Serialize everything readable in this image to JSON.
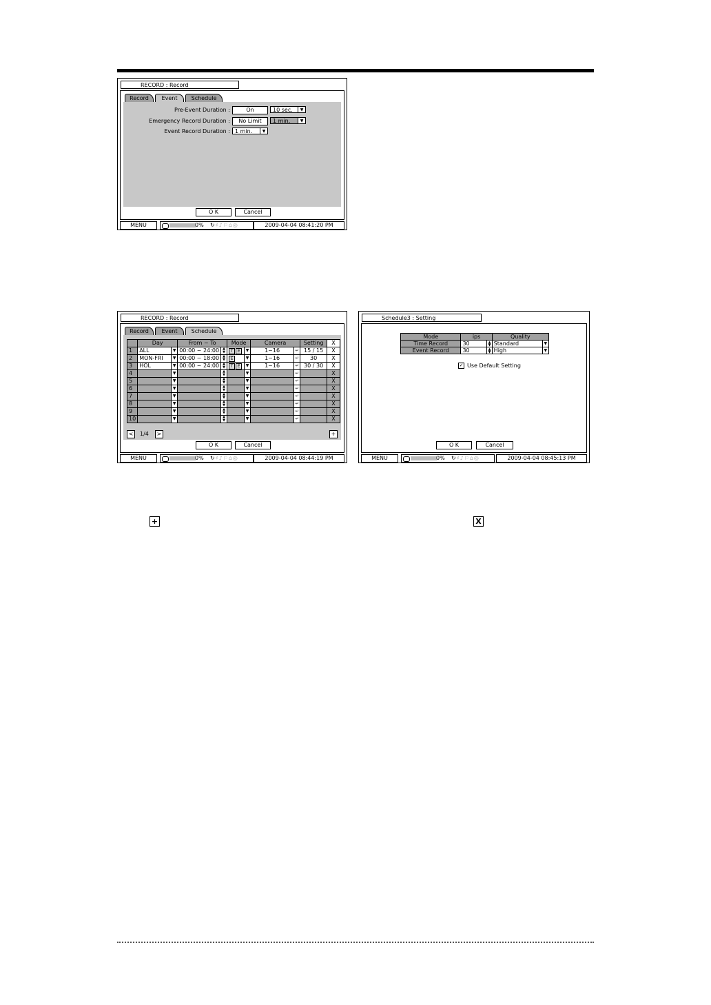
{
  "screens": {
    "event": {
      "title": "RECORD : Record",
      "tabs": [
        "Record",
        "Event",
        "Schedule"
      ],
      "active_tab": "Event",
      "rows": [
        {
          "label": "Pre-Event Duration :",
          "value": "On",
          "select": "10 sec."
        },
        {
          "label": "Emergency Record Duration :",
          "value": "No Limit",
          "select": "1 min."
        },
        {
          "label": "Event Record Duration :",
          "select": "1 min."
        }
      ],
      "ok": "O K",
      "cancel": "Cancel",
      "status": {
        "menu": "MENU",
        "pct": "0%",
        "time": "2009-04-04  08:41:20 PM"
      }
    },
    "schedule": {
      "title": "RECORD : Record",
      "tabs": [
        "Record",
        "Event",
        "Schedule"
      ],
      "active_tab": "Schedule",
      "columns": [
        "Day",
        "From ~ To",
        "Mode",
        "Camera",
        "Setting",
        "X"
      ],
      "rows": [
        {
          "num": "1",
          "day": "ALL",
          "time": "00:00 ~ 24:00",
          "mode": [
            "T",
            "E"
          ],
          "camera": "1~16",
          "setting": "15 / 15",
          "x": "X"
        },
        {
          "num": "2",
          "day": "MON-FRI",
          "time": "00:00 ~ 18:00",
          "mode": [
            "E"
          ],
          "camera": "1~16",
          "setting": "30",
          "x": "X"
        },
        {
          "num": "3",
          "day": "HOL",
          "time": "00:00 ~ 24:00",
          "mode": [
            "T",
            "E"
          ],
          "camera": "1~16",
          "setting": "30 / 30",
          "x": "X"
        },
        {
          "num": "4",
          "x": "X"
        },
        {
          "num": "5",
          "x": "X"
        },
        {
          "num": "6",
          "x": "X"
        },
        {
          "num": "7",
          "x": "X"
        },
        {
          "num": "8",
          "x": "X"
        },
        {
          "num": "9",
          "x": "X"
        },
        {
          "num": "10",
          "x": "X"
        }
      ],
      "page": "1/4",
      "add": "+",
      "ok": "O K",
      "cancel": "Cancel",
      "status": {
        "menu": "MENU",
        "pct": "0%",
        "time": "2009-04-04  08:44:19 PM"
      }
    },
    "setting": {
      "title": "Schedule3 : Setting",
      "columns": [
        "Mode",
        "ips",
        "Quality"
      ],
      "rows": [
        {
          "mode": "Time Record",
          "ips": "30",
          "quality": "Standard"
        },
        {
          "mode": "Event Record",
          "ips": "30",
          "quality": "High"
        }
      ],
      "checkbox_label": "Use Default Setting",
      "ok": "O K",
      "cancel": "Cancel",
      "status": {
        "menu": "MENU",
        "pct": "0%",
        "time": "2009-04-04  08:45:13 PM"
      }
    }
  },
  "legend_icons": {
    "add": "+",
    "delete": "X"
  }
}
